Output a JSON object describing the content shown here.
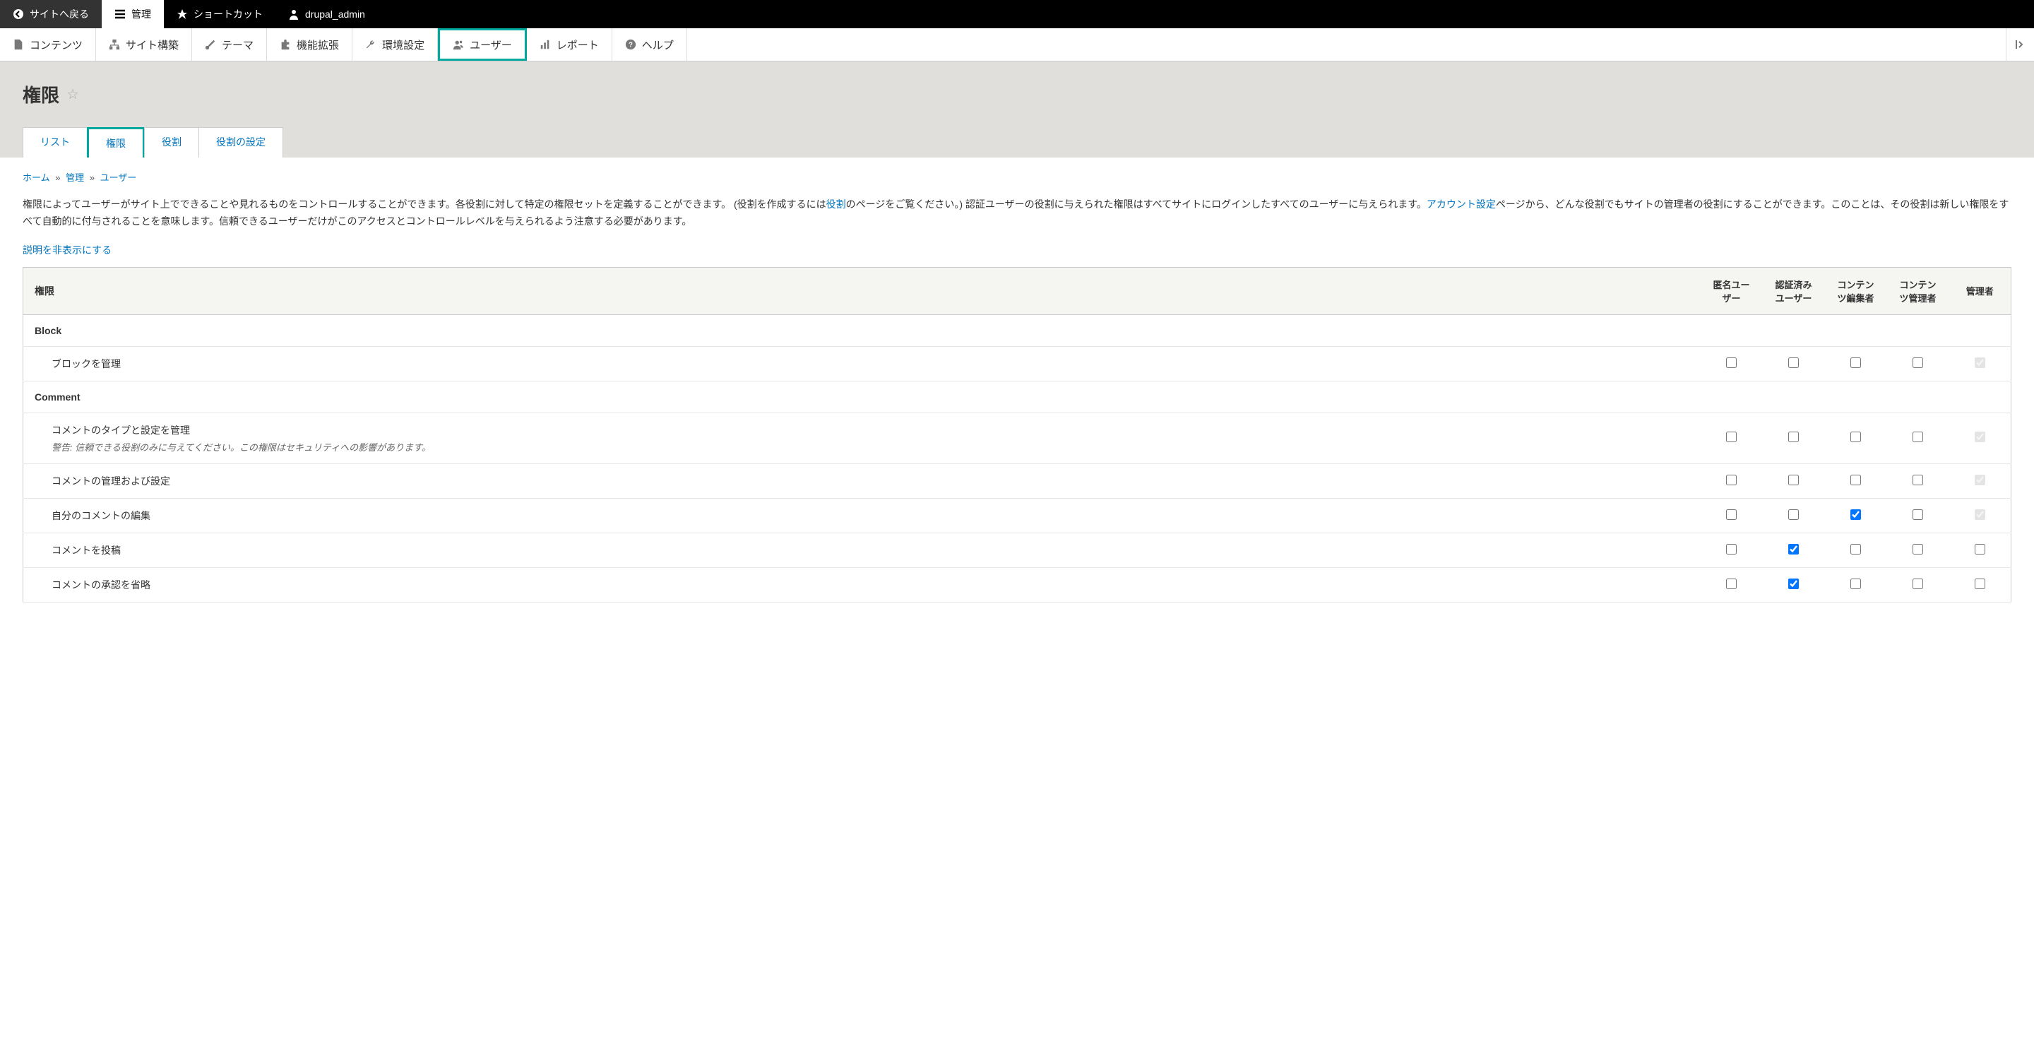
{
  "toolbar": {
    "back": "サイトへ戻る",
    "manage": "管理",
    "shortcuts": "ショートカット",
    "user": "drupal_admin"
  },
  "menu": {
    "content": "コンテンツ",
    "structure": "サイト構築",
    "appearance": "テーマ",
    "extend": "機能拡張",
    "config": "環境設定",
    "people": "ユーザー",
    "reports": "レポート",
    "help": "ヘルプ"
  },
  "page": {
    "title": "権限"
  },
  "tabs": {
    "list": "リスト",
    "permissions": "権限",
    "roles": "役割",
    "role_settings": "役割の設定"
  },
  "breadcrumb": {
    "home": "ホーム",
    "admin": "管理",
    "people": "ユーザー"
  },
  "description": {
    "part1": "権限によってユーザーがサイト上でできることや見れるものをコントロールすることができます。各役割に対して特定の権限セットを定義することができます。 (役割を作成するには",
    "roles_link": "役割",
    "part2": "のページをご覧ください。) 認証ユーザーの役割に与えられた権限はすべてサイトにログインしたすべてのユーザーに与えられます。",
    "account_link": "アカウント設定",
    "part3": "ページから、どんな役割でもサイトの管理者の役割にすることができます。このことは、その役割は新しい権限をすべて自動的に付与されることを意味します。信頼できるユーザーだけがこのアクセスとコントロールレベルを与えられるよう注意する必要があります。"
  },
  "toggle_description": "説明を非表示にする",
  "table": {
    "headers": {
      "permission": "権限",
      "anonymous": "匿名ユーザー",
      "authenticated": "認証済みユーザー",
      "content_editor": "コンテンツ編集者",
      "content_admin": "コンテンツ管理者",
      "administrator": "管理者"
    },
    "modules": [
      {
        "name": "Block",
        "permissions": [
          {
            "label": "ブロックを管理",
            "warning": "",
            "checks": [
              false,
              false,
              false,
              false,
              "disabled-checked"
            ]
          }
        ]
      },
      {
        "name": "Comment",
        "permissions": [
          {
            "label": "コメントのタイプと設定を管理",
            "warning": "警告: 信頼できる役割のみに与えてください。この権限はセキュリティへの影響があります。",
            "checks": [
              false,
              false,
              false,
              false,
              "disabled-checked"
            ]
          },
          {
            "label": "コメントの管理および設定",
            "warning": "",
            "checks": [
              false,
              false,
              false,
              false,
              "disabled-checked"
            ]
          },
          {
            "label": "自分のコメントの編集",
            "warning": "",
            "checks": [
              false,
              false,
              true,
              false,
              "disabled-checked"
            ]
          },
          {
            "label": "コメントを投稿",
            "warning": "",
            "checks": [
              false,
              true,
              false,
              false,
              false
            ]
          },
          {
            "label": "コメントの承認を省略",
            "warning": "",
            "checks": [
              false,
              true,
              false,
              false,
              false
            ]
          }
        ]
      }
    ]
  }
}
